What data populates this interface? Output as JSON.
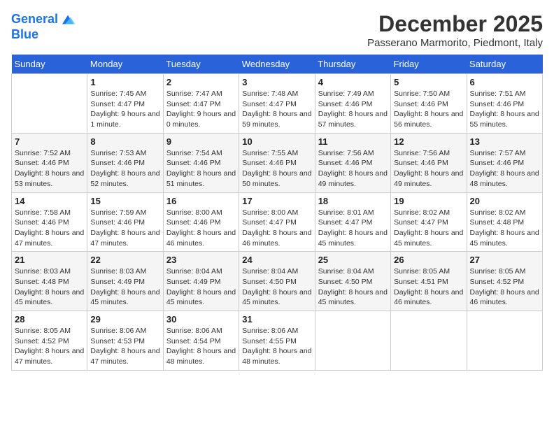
{
  "header": {
    "logo_line1": "General",
    "logo_line2": "Blue",
    "month_title": "December 2025",
    "location": "Passerano Marmorito, Piedmont, Italy"
  },
  "days_of_week": [
    "Sunday",
    "Monday",
    "Tuesday",
    "Wednesday",
    "Thursday",
    "Friday",
    "Saturday"
  ],
  "weeks": [
    [
      {
        "num": "",
        "sunrise": "",
        "sunset": "",
        "daylight": "",
        "empty": true
      },
      {
        "num": "1",
        "sunrise": "Sunrise: 7:45 AM",
        "sunset": "Sunset: 4:47 PM",
        "daylight": "Daylight: 9 hours and 1 minute."
      },
      {
        "num": "2",
        "sunrise": "Sunrise: 7:47 AM",
        "sunset": "Sunset: 4:47 PM",
        "daylight": "Daylight: 9 hours and 0 minutes."
      },
      {
        "num": "3",
        "sunrise": "Sunrise: 7:48 AM",
        "sunset": "Sunset: 4:47 PM",
        "daylight": "Daylight: 8 hours and 59 minutes."
      },
      {
        "num": "4",
        "sunrise": "Sunrise: 7:49 AM",
        "sunset": "Sunset: 4:46 PM",
        "daylight": "Daylight: 8 hours and 57 minutes."
      },
      {
        "num": "5",
        "sunrise": "Sunrise: 7:50 AM",
        "sunset": "Sunset: 4:46 PM",
        "daylight": "Daylight: 8 hours and 56 minutes."
      },
      {
        "num": "6",
        "sunrise": "Sunrise: 7:51 AM",
        "sunset": "Sunset: 4:46 PM",
        "daylight": "Daylight: 8 hours and 55 minutes."
      }
    ],
    [
      {
        "num": "7",
        "sunrise": "Sunrise: 7:52 AM",
        "sunset": "Sunset: 4:46 PM",
        "daylight": "Daylight: 8 hours and 53 minutes."
      },
      {
        "num": "8",
        "sunrise": "Sunrise: 7:53 AM",
        "sunset": "Sunset: 4:46 PM",
        "daylight": "Daylight: 8 hours and 52 minutes."
      },
      {
        "num": "9",
        "sunrise": "Sunrise: 7:54 AM",
        "sunset": "Sunset: 4:46 PM",
        "daylight": "Daylight: 8 hours and 51 minutes."
      },
      {
        "num": "10",
        "sunrise": "Sunrise: 7:55 AM",
        "sunset": "Sunset: 4:46 PM",
        "daylight": "Daylight: 8 hours and 50 minutes."
      },
      {
        "num": "11",
        "sunrise": "Sunrise: 7:56 AM",
        "sunset": "Sunset: 4:46 PM",
        "daylight": "Daylight: 8 hours and 49 minutes."
      },
      {
        "num": "12",
        "sunrise": "Sunrise: 7:56 AM",
        "sunset": "Sunset: 4:46 PM",
        "daylight": "Daylight: 8 hours and 49 minutes."
      },
      {
        "num": "13",
        "sunrise": "Sunrise: 7:57 AM",
        "sunset": "Sunset: 4:46 PM",
        "daylight": "Daylight: 8 hours and 48 minutes."
      }
    ],
    [
      {
        "num": "14",
        "sunrise": "Sunrise: 7:58 AM",
        "sunset": "Sunset: 4:46 PM",
        "daylight": "Daylight: 8 hours and 47 minutes."
      },
      {
        "num": "15",
        "sunrise": "Sunrise: 7:59 AM",
        "sunset": "Sunset: 4:46 PM",
        "daylight": "Daylight: 8 hours and 47 minutes."
      },
      {
        "num": "16",
        "sunrise": "Sunrise: 8:00 AM",
        "sunset": "Sunset: 4:46 PM",
        "daylight": "Daylight: 8 hours and 46 minutes."
      },
      {
        "num": "17",
        "sunrise": "Sunrise: 8:00 AM",
        "sunset": "Sunset: 4:47 PM",
        "daylight": "Daylight: 8 hours and 46 minutes."
      },
      {
        "num": "18",
        "sunrise": "Sunrise: 8:01 AM",
        "sunset": "Sunset: 4:47 PM",
        "daylight": "Daylight: 8 hours and 45 minutes."
      },
      {
        "num": "19",
        "sunrise": "Sunrise: 8:02 AM",
        "sunset": "Sunset: 4:47 PM",
        "daylight": "Daylight: 8 hours and 45 minutes."
      },
      {
        "num": "20",
        "sunrise": "Sunrise: 8:02 AM",
        "sunset": "Sunset: 4:48 PM",
        "daylight": "Daylight: 8 hours and 45 minutes."
      }
    ],
    [
      {
        "num": "21",
        "sunrise": "Sunrise: 8:03 AM",
        "sunset": "Sunset: 4:48 PM",
        "daylight": "Daylight: 8 hours and 45 minutes."
      },
      {
        "num": "22",
        "sunrise": "Sunrise: 8:03 AM",
        "sunset": "Sunset: 4:49 PM",
        "daylight": "Daylight: 8 hours and 45 minutes."
      },
      {
        "num": "23",
        "sunrise": "Sunrise: 8:04 AM",
        "sunset": "Sunset: 4:49 PM",
        "daylight": "Daylight: 8 hours and 45 minutes."
      },
      {
        "num": "24",
        "sunrise": "Sunrise: 8:04 AM",
        "sunset": "Sunset: 4:50 PM",
        "daylight": "Daylight: 8 hours and 45 minutes."
      },
      {
        "num": "25",
        "sunrise": "Sunrise: 8:04 AM",
        "sunset": "Sunset: 4:50 PM",
        "daylight": "Daylight: 8 hours and 45 minutes."
      },
      {
        "num": "26",
        "sunrise": "Sunrise: 8:05 AM",
        "sunset": "Sunset: 4:51 PM",
        "daylight": "Daylight: 8 hours and 46 minutes."
      },
      {
        "num": "27",
        "sunrise": "Sunrise: 8:05 AM",
        "sunset": "Sunset: 4:52 PM",
        "daylight": "Daylight: 8 hours and 46 minutes."
      }
    ],
    [
      {
        "num": "28",
        "sunrise": "Sunrise: 8:05 AM",
        "sunset": "Sunset: 4:52 PM",
        "daylight": "Daylight: 8 hours and 47 minutes."
      },
      {
        "num": "29",
        "sunrise": "Sunrise: 8:06 AM",
        "sunset": "Sunset: 4:53 PM",
        "daylight": "Daylight: 8 hours and 47 minutes."
      },
      {
        "num": "30",
        "sunrise": "Sunrise: 8:06 AM",
        "sunset": "Sunset: 4:54 PM",
        "daylight": "Daylight: 8 hours and 48 minutes."
      },
      {
        "num": "31",
        "sunrise": "Sunrise: 8:06 AM",
        "sunset": "Sunset: 4:55 PM",
        "daylight": "Daylight: 8 hours and 48 minutes."
      },
      {
        "num": "",
        "sunrise": "",
        "sunset": "",
        "daylight": "",
        "empty": true
      },
      {
        "num": "",
        "sunrise": "",
        "sunset": "",
        "daylight": "",
        "empty": true
      },
      {
        "num": "",
        "sunrise": "",
        "sunset": "",
        "daylight": "",
        "empty": true
      }
    ]
  ]
}
